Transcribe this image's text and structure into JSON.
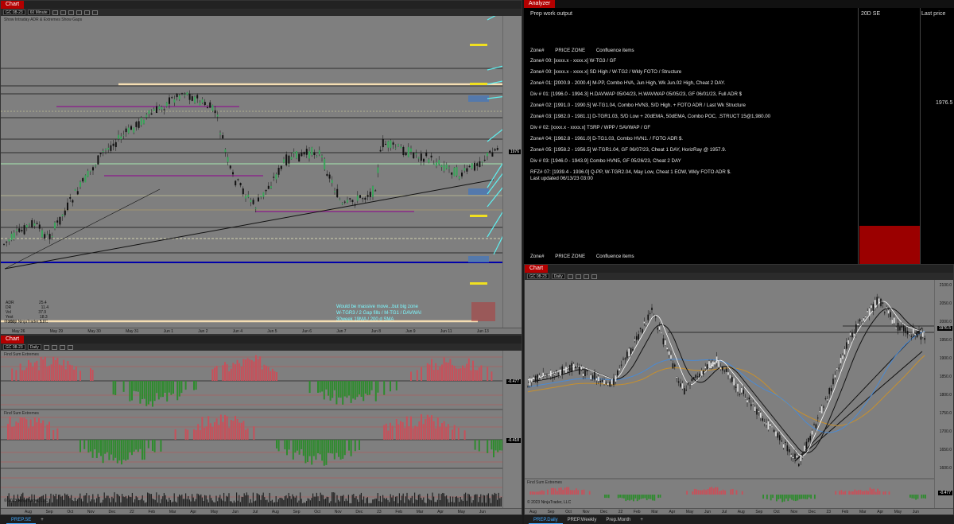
{
  "left_chart": {
    "title": "Chart",
    "instrument": "GC 08-23",
    "interval": "60 Minute",
    "indicator_label": "Show Intraday ADR & Extremes  Show Gaps",
    "last_price": "1976",
    "annotation": [
      "Would be massive move...but big zone",
      "W-TGR3 / 2 Gap fills / M-TG1 / DAVWAI",
      "30week 19MA / 200 d SMA"
    ],
    "copyright": "© 2023 NinjaTrader, LLC",
    "dates": [
      "May 26",
      "May 29",
      "May 30",
      "May 31",
      "Jun 1",
      "Jun 2",
      "Jun 4",
      "Jun 5",
      "Jun 6",
      "Jun 7",
      "Jun 8",
      "Jun 9",
      "Jun 11",
      "Jun 13"
    ],
    "stats": [
      {
        "k": "ADR",
        "v": "25.4"
      },
      {
        "k": "DR",
        "v": "11.4"
      },
      {
        "k": "Vol",
        "v": "37.9"
      },
      {
        "k": "Yest",
        "v": "18.3"
      },
      {
        "k": "Today",
        "v": "5.7"
      }
    ]
  },
  "bottom_left_chart": {
    "title": "Chart",
    "instrument": "GC 08-23",
    "interval": "Daily",
    "pane1_label": "Find Sum Extremes",
    "pane2_label": "Find Sum Extremes",
    "value1": "-0.477",
    "value2": "-0.418",
    "copyright": "© 2023 NinjaTrader, LLC",
    "months": [
      "Aug",
      "Sep",
      "Oct",
      "Nov",
      "Dec",
      "22",
      "Feb",
      "Mar",
      "Apr",
      "May",
      "Jun",
      "Jul",
      "Aug",
      "Sep",
      "Oct",
      "Nov",
      "Dec",
      "23",
      "Feb",
      "Mar",
      "Apr",
      "May",
      "Jun"
    ]
  },
  "analyzer": {
    "title": "Analyzer",
    "workspace": "Prep work output",
    "col2": "20D SE",
    "col3": "Last price",
    "last_price_value": "1976.5",
    "header": {
      "zone": "Zone#",
      "price_zone": "PRICE ZONE",
      "confluence": "Confluence items"
    },
    "lines": [
      "Zone# 00: [xxxx.x - xxxx.x] W-TG3 / GF",
      "Zone# 00: [xxxx.x - xxxx.x] SD High / W-TG2 / Wkly FOTO / Structure",
      "Zone# 01: [2000.9 - 2000.4] M-PP, Combo HVA, Jun High, Wk Jun.02 High, Cheat 2 DAY.",
      "Div # 01: [1996.0 - 1994.3] H.DAVWAP 05/04/23, H.WAVWAP 05/05/23, GF 06/01/23, Full ADR $",
      "Zone# 02: [1991.0 - 1990.5] W-TG1.04, Combo HVN3, S/D High. + FOTO ADR / Last Wk Structure",
      "Zone# 03: [1982.0 - 1981.1] D-TGR1.03, S/D Low + 20dEMA, 50dEMA, Combo POC, .STRUCT 15@1,980.00",
      "Div # 02: [xxxx.x - xxxx.x] TSRP / WPP / SAVWAP / GF",
      "Zone# 04: [1962.8 - 1961.0] D-TG1.03, Combo HVN1. / FOTO ADR $.",
      "Zone# 05: [1958.2 - 1956.5] W-TGR1.04, GF 06/07/23, Cheat 1 DAY, HorizRay @ 1957.9.",
      "Div # 03: [1946.0 - 1943.9] Combo HVN5, GF 05/26/23, Cheat 2 DAY",
      "RFZ# 07: [1939.4 - 1936.0] Q-PP, W-TGR2.04, May Low, Cheat 1 EOW, Wkly FOTO ADR $.",
      "Last updated 06/13/23 03:00"
    ],
    "footer": {
      "zone": "Zone#",
      "price_zone": "PRICE ZONE",
      "confluence": "Confluence items"
    }
  },
  "right_chart": {
    "title": "Chart",
    "instrument": "GC 08-23",
    "interval": "Daily",
    "last_price": "1976.5",
    "pane_label": "Find Sum Extremes",
    "value": "-0.477",
    "copyright": "© 2023 NinjaTrader, LLC",
    "months": [
      "Aug",
      "Sep",
      "Oct",
      "Nov",
      "Dec",
      "22",
      "Feb",
      "Mar",
      "Apr",
      "May",
      "Jun",
      "Jul",
      "Aug",
      "Sep",
      "Oct",
      "Nov",
      "Dec",
      "23",
      "Feb",
      "Mar",
      "Apr",
      "May",
      "Jun"
    ],
    "prices": [
      "2100.0",
      "2050.0",
      "2000.0",
      "1950.0",
      "1900.0",
      "1850.0",
      "1800.0",
      "1750.0",
      "1700.0",
      "1650.0",
      "1600.0"
    ]
  },
  "tabs_left": [
    "PREP.SE"
  ],
  "tabs_right": [
    "PREP.Daily",
    "PREP.Weekly",
    "Prep.Month"
  ],
  "colors": {
    "accent_red": "#b30000",
    "bull": "#2e8b2e",
    "bear": "#c8505a",
    "cyan": "#5ff0f0",
    "gold": "#f0d060"
  }
}
